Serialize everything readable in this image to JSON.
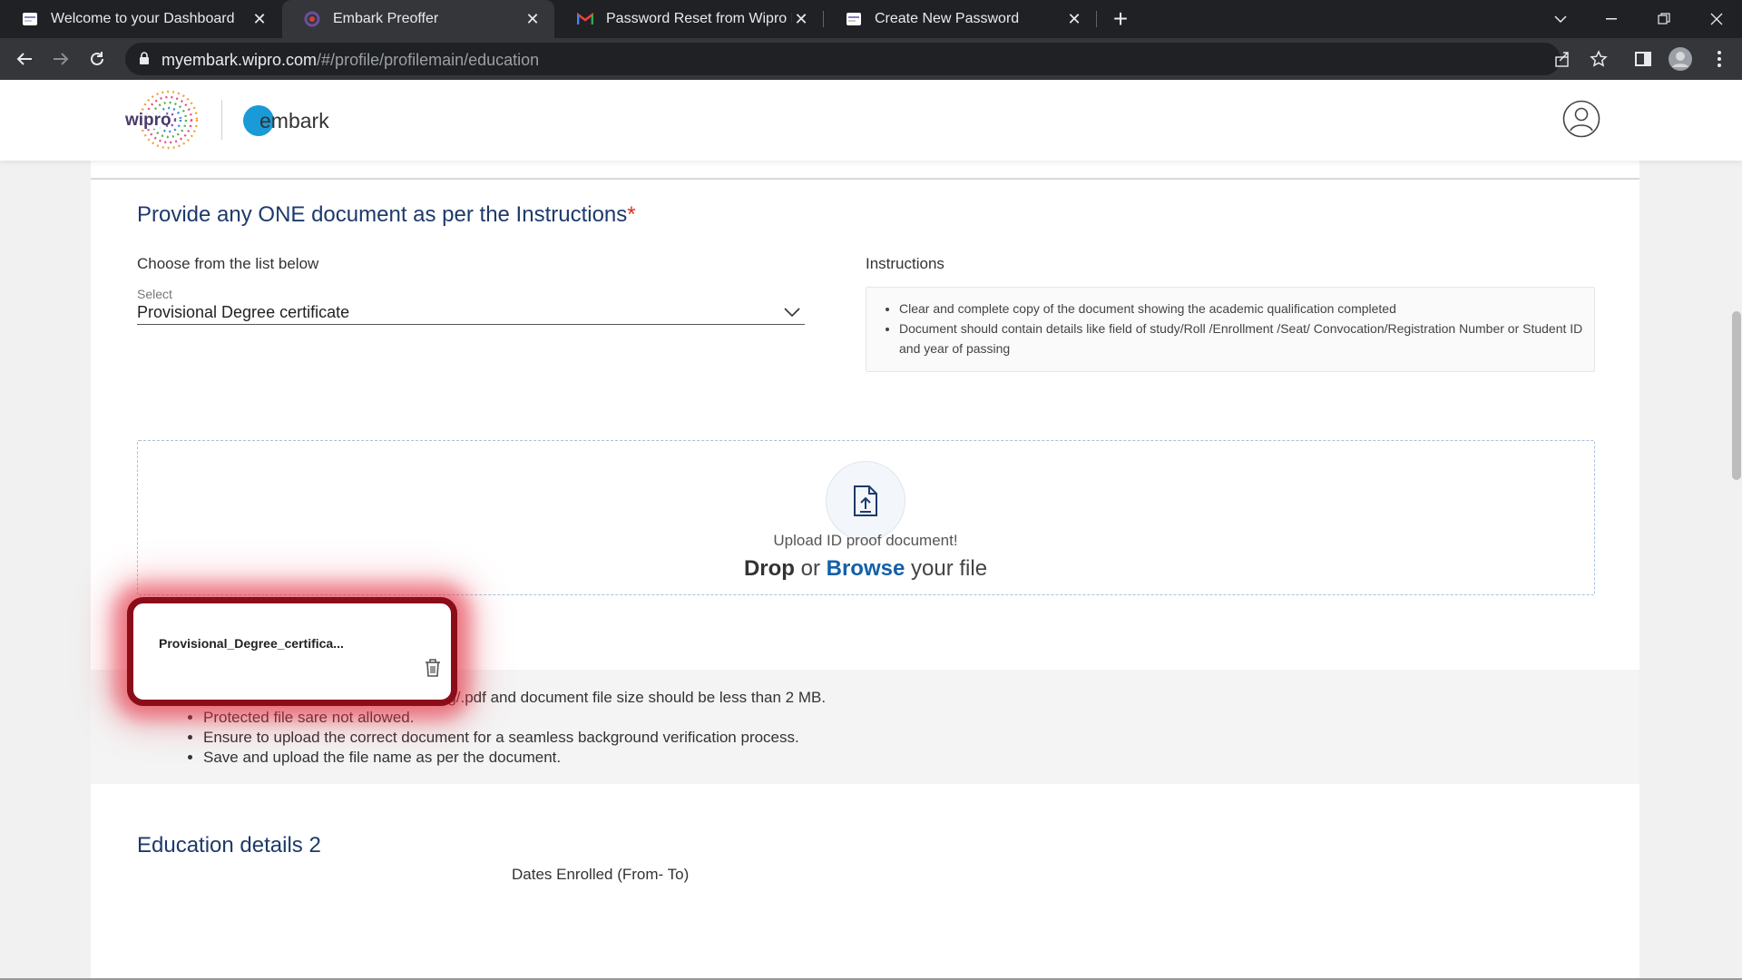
{
  "browser": {
    "tabs": [
      {
        "title": "Welcome to your Dashboard",
        "icon": "wipro-favicon-icon",
        "active": false
      },
      {
        "title": "Embark Preoffer",
        "icon": "embark-favicon-icon",
        "active": true
      },
      {
        "title": "Password Reset from Wipro Limi",
        "icon": "gmail-icon",
        "active": false
      },
      {
        "title": "Create New Password",
        "icon": "wipro-favicon-icon",
        "active": false
      }
    ],
    "url_host": "myembark.wipro.com",
    "url_path": "/#/profile/profilemain/education"
  },
  "header": {
    "brand": "wipro",
    "app_name_rest": "mbark",
    "app_name_first": "e"
  },
  "documents": {
    "title": "Provide any ONE document as per the Instructions",
    "required_mark": "*",
    "choose_label": "Choose from the list below",
    "select_caption": "Select",
    "select_value": "Provisional Degree certificate",
    "instructions_label": "Instructions",
    "instructions": [
      "Clear and complete copy of the document showing the academic qualification completed",
      "Document should contain details like field of study/Roll /Enrollment /Seat/ Convocation/Registration Number or Student ID and year of passing"
    ],
    "upload_label": "Upload ID proof document!",
    "drop_word": "Drop",
    "or_word": "or",
    "browse_word": "Browse",
    "your_file": "your file",
    "uploaded_file_name": "Provisional_Degree_certifica..."
  },
  "notes": [
    "Document format should be .png/.jpg/.pdf and document file size should be less than 2 MB.",
    "Protected file sare not allowed.",
    "Ensure to upload the correct document for a seamless background verification process.",
    "Save and upload the file name as per the document."
  ],
  "education2": {
    "title": "Education details 2",
    "dates_label": "Dates Enrolled (From- To)"
  },
  "colors": {
    "title_blue": "#1d3a6b",
    "browse_blue": "#1460a8",
    "highlight_red": "#8b0d1a",
    "embark_blue": "#1a9bd7"
  }
}
